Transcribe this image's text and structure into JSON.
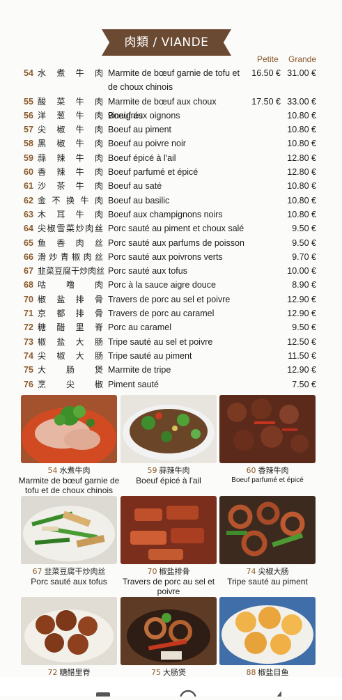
{
  "section": {
    "title": "肉類 / VIANDE"
  },
  "columns": {
    "small": "Petite",
    "large": "Grande"
  },
  "items": [
    {
      "num": "54",
      "zh": "水煮牛肉",
      "fr": "Marmite de bœuf garnie de tofu et de choux chinois",
      "small": "16.50 €",
      "large": "31.00 €"
    },
    {
      "num": "55",
      "zh": "酸菜牛肉",
      "fr": "Marmite de bœuf aux choux vinaigrés",
      "small": "17.50 €",
      "large": "33.00 €"
    },
    {
      "num": "56",
      "zh": "洋葱牛肉",
      "fr": "Boeuf aux oignons",
      "small": "",
      "large": "10.80 €"
    },
    {
      "num": "57",
      "zh": "尖椒牛肉",
      "fr": "Boeuf au piment",
      "small": "",
      "large": "10.80 €"
    },
    {
      "num": "58",
      "zh": "黑椒牛肉",
      "fr": "Boeuf au poivre noir",
      "small": "",
      "large": "10.80 €"
    },
    {
      "num": "59",
      "zh": "蒜辣牛肉",
      "fr": "Boeuf épicé à l'ail",
      "small": "",
      "large": "12.80 €"
    },
    {
      "num": "60",
      "zh": "香辣牛肉",
      "fr": "Boeuf parfumé et épicé",
      "small": "",
      "large": "12.80 €"
    },
    {
      "num": "61",
      "zh": "沙茶牛肉",
      "fr": "Boeuf au saté",
      "small": "",
      "large": "10.80 €"
    },
    {
      "num": "62",
      "zh": "金不换牛肉",
      "fr": "Boeuf au basilic",
      "small": "",
      "large": "10.80 €"
    },
    {
      "num": "63",
      "zh": "木耳牛肉",
      "fr": "Boeuf aux champignons noirs",
      "small": "",
      "large": "10.80 €"
    },
    {
      "num": "64",
      "zh": "尖椒雪菜炒肉丝",
      "fr": "Porc sauté au piment et choux salé",
      "small": "",
      "large": "9.50 €"
    },
    {
      "num": "65",
      "zh": "鱼香肉丝",
      "fr": "Porc sauté aux parfums de poisson",
      "small": "",
      "large": "9.50 €"
    },
    {
      "num": "66",
      "zh": "滑炒青椒肉丝",
      "fr": "Porc sauté aux poivrons verts",
      "small": "",
      "large": "9.70 €"
    },
    {
      "num": "67",
      "zh": "韭菜豆腐干炒肉丝",
      "fr": "Porc sauté aux tofus",
      "small": "",
      "large": "10.00 €"
    },
    {
      "num": "68",
      "zh": "咕噜肉",
      "fr": "Porc à la sauce aigre douce",
      "small": "",
      "large": "8.90 €"
    },
    {
      "num": "70",
      "zh": "椒盐排骨",
      "fr": "Travers de porc au sel et poivre",
      "small": "",
      "large": "12.90 €"
    },
    {
      "num": "71",
      "zh": "京都排骨",
      "fr": "Travers de porc au caramel",
      "small": "",
      "large": "12.90 €"
    },
    {
      "num": "72",
      "zh": "糖醋里脊",
      "fr": "Porc au caramel",
      "small": "",
      "large": "9.50 €"
    },
    {
      "num": "73",
      "zh": "椒盐大肠",
      "fr": "Tripe sauté au sel et poivre",
      "small": "",
      "large": "12.50 €"
    },
    {
      "num": "74",
      "zh": "尖椒大肠",
      "fr": "Tripe sauté au piment",
      "small": "",
      "large": "11.50 €"
    },
    {
      "num": "75",
      "zh": "大肠煲",
      "fr": "Marmite de tripe",
      "small": "",
      "large": "12.90 €"
    },
    {
      "num": "76",
      "zh": "烹尖椒",
      "fr": "Piment sauté",
      "small": "",
      "large": "7.50 €"
    }
  ],
  "photos": [
    {
      "num": "54",
      "zh": "水煮牛肉",
      "fr": "Marmite de bœuf garnie de tofu et de choux chinois"
    },
    {
      "num": "59",
      "zh": "蒜辣牛肉",
      "fr": "Boeuf épicé à l'ail"
    },
    {
      "num": "60",
      "zh": "香辣牛肉",
      "fr": "Boeuf parfumé et épicé"
    },
    {
      "num": "67",
      "zh": "韭菜豆腐干炒肉丝",
      "fr": "Porc sauté aux tofus"
    },
    {
      "num": "70",
      "zh": "椒盐排骨",
      "fr": "Travers de porc au sel et poivre"
    },
    {
      "num": "74",
      "zh": "尖椒大肠",
      "fr": "Tripe sauté au piment"
    },
    {
      "num": "72",
      "zh": "糖醋里脊",
      "fr": ""
    },
    {
      "num": "75",
      "zh": "大肠煲",
      "fr": ""
    },
    {
      "num": "88",
      "zh": "椒盐目鱼",
      "fr": ""
    }
  ],
  "nav": {
    "back_icon": "back-icon",
    "home_icon": "home-icon",
    "recents_icon": "recents-icon"
  }
}
